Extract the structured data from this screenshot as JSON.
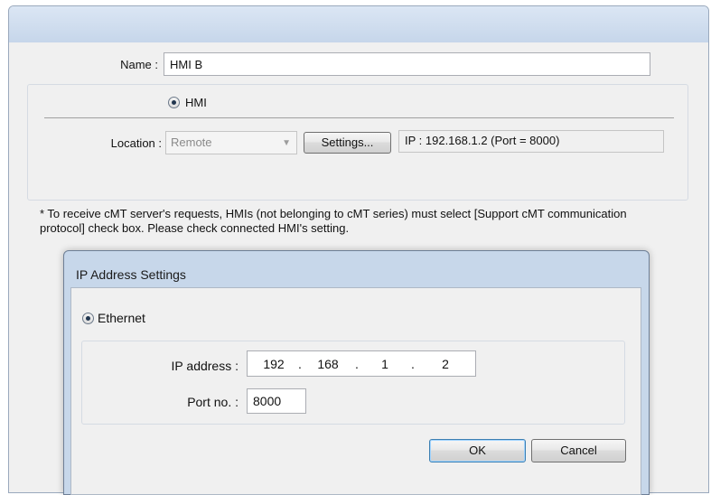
{
  "main_dialog": {
    "name_label": "Name :",
    "name_value": "HMI B",
    "hmi_radio_label": "HMI",
    "location_label": "Location :",
    "location_value": "Remote",
    "settings_button": "Settings...",
    "ip_summary": "IP : 192.168.1.2 (Port = 8000)",
    "note": "* To receive cMT server's requests, HMIs (not belonging to cMT series) must select [Support cMT communication protocol] check box. Please check connected HMI's setting."
  },
  "ip_dialog": {
    "title": "IP Address Settings",
    "ethernet_radio_label": "Ethernet",
    "ip_address_label": "IP address :",
    "ip_octets": [
      "192",
      "168",
      "1",
      "2"
    ],
    "port_label": "Port no. :",
    "port_value": "8000",
    "ok_button": "OK",
    "cancel_button": "Cancel"
  },
  "colors": {
    "titlebar": "#c6d6ea",
    "dialog_background": "#f0f0f0",
    "default_button_border": "#3c7fb1"
  },
  "icons": {
    "dropdown": "chevron-down-icon",
    "radio_selected": "radio-selected-icon"
  }
}
